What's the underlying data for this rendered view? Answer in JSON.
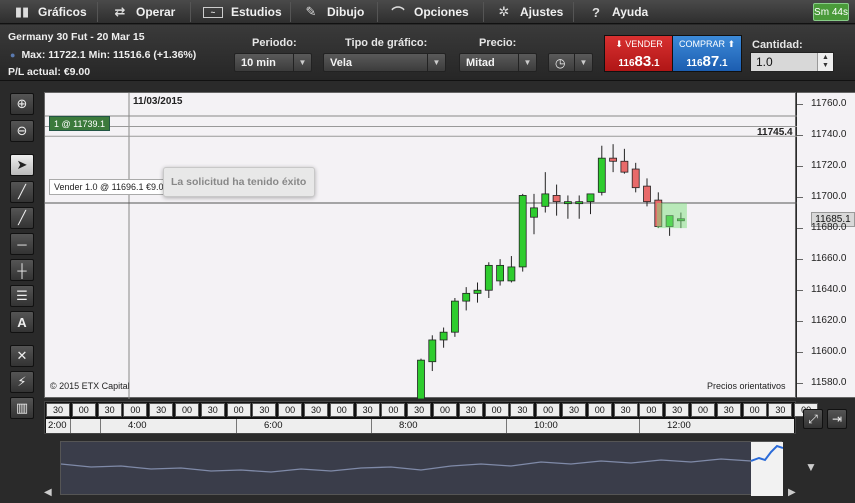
{
  "menu": {
    "graficos": "Gráficos",
    "operar": "Operar",
    "estudios": "Estudios",
    "dibujo": "Dibujo",
    "opciones": "Opciones",
    "ajustes": "Ajustes",
    "ayuda": "Ayuda",
    "timer": "Sm 44s"
  },
  "instrument": {
    "name": "Germany 30 Fut - 20 Mar 15",
    "range": "Max: 11722.1 Min: 11516.6 (+1.36%)",
    "pl": "P/L actual: €9.00"
  },
  "controls": {
    "period_label": "Periodo:",
    "period_value": "10 min",
    "charttype_label": "Tipo de gráfico:",
    "charttype_value": "Vela",
    "price_label": "Precio:",
    "price_value": "Mitad",
    "qty_label": "Cantidad:",
    "qty_value": "1.0"
  },
  "trade": {
    "sell_label": "VENDER",
    "sell_main": "116",
    "sell_big": "83",
    "sell_small": ".1",
    "buy_label": "COMPRAR",
    "buy_main": "116",
    "buy_big": "87",
    "buy_small": ".1"
  },
  "chart": {
    "date_label": "11/03/2015",
    "order_tag": "1 @ 11739.1",
    "position_tag": "Vender 1.0 @ 11696.1 €9.00",
    "toast": "La solicitud ha tenido éxito",
    "level_label": "11745.4",
    "last_price": "11685.1",
    "copyright": "© 2015 ETX Capital",
    "note": "Precios orientativos"
  },
  "chart_data": {
    "type": "candlestick",
    "ylim": [
      11570,
      11765
    ],
    "yticks": [
      11580.0,
      11600.0,
      11620.0,
      11640.0,
      11660.0,
      11680.0,
      11700.0,
      11720.0,
      11740.0,
      11760.0
    ],
    "tick_labels": [
      "11580.0",
      "11600.0",
      "11620.0",
      "11640.0",
      "11660.0",
      "11680.0",
      "11700.0",
      "11720.0",
      "11740.0",
      "11760.0"
    ],
    "horizontal_lines": [
      11745.4,
      11739.1,
      11696.1
    ],
    "candles": [
      {
        "o": 11570,
        "h": 11596,
        "l": 11560,
        "c": 11595,
        "up": true
      },
      {
        "o": 11594,
        "h": 11611,
        "l": 11588,
        "c": 11608,
        "up": true
      },
      {
        "o": 11608,
        "h": 11616,
        "l": 11603,
        "c": 11613,
        "up": true
      },
      {
        "o": 11613,
        "h": 11635,
        "l": 11610,
        "c": 11633,
        "up": true
      },
      {
        "o": 11633,
        "h": 11642,
        "l": 11627,
        "c": 11638,
        "up": true
      },
      {
        "o": 11638,
        "h": 11645,
        "l": 11632,
        "c": 11640,
        "up": true
      },
      {
        "o": 11640,
        "h": 11658,
        "l": 11635,
        "c": 11656,
        "up": true
      },
      {
        "o": 11646,
        "h": 11660,
        "l": 11643,
        "c": 11656,
        "up": true
      },
      {
        "o": 11646,
        "h": 11662,
        "l": 11645,
        "c": 11655,
        "up": true
      },
      {
        "o": 11655,
        "h": 11702,
        "l": 11652,
        "c": 11701,
        "up": true
      },
      {
        "o": 11687,
        "h": 11702,
        "l": 11676,
        "c": 11693,
        "up": true
      },
      {
        "o": 11694,
        "h": 11716,
        "l": 11690,
        "c": 11702,
        "up": true
      },
      {
        "o": 11701,
        "h": 11708,
        "l": 11688,
        "c": 11697,
        "up": false
      },
      {
        "o": 11697,
        "h": 11701,
        "l": 11686,
        "c": 11696,
        "up": true
      },
      {
        "o": 11697,
        "h": 11701,
        "l": 11686,
        "c": 11697,
        "up": true
      },
      {
        "o": 11697,
        "h": 11702,
        "l": 11689,
        "c": 11702,
        "up": true
      },
      {
        "o": 11703,
        "h": 11733,
        "l": 11701,
        "c": 11725,
        "up": true
      },
      {
        "o": 11725,
        "h": 11734,
        "l": 11716,
        "c": 11723,
        "up": false
      },
      {
        "o": 11723,
        "h": 11731,
        "l": 11715,
        "c": 11716,
        "up": false
      },
      {
        "o": 11718,
        "h": 11722,
        "l": 11703,
        "c": 11706,
        "up": false
      },
      {
        "o": 11707,
        "h": 11712,
        "l": 11694,
        "c": 11697,
        "up": false
      },
      {
        "o": 11698,
        "h": 11703,
        "l": 11680,
        "c": 11681,
        "up": false
      },
      {
        "o": 11681,
        "h": 11688,
        "l": 11675,
        "c": 11688,
        "up": true
      },
      {
        "o": 11685,
        "h": 11690,
        "l": 11680,
        "c": 11686,
        "up": true
      }
    ],
    "time_cells": [
      "30",
      "00",
      "30",
      "00",
      "30",
      "00",
      "30",
      "00",
      "30",
      "00",
      "30",
      "00",
      "30",
      "00",
      "30",
      "00",
      "30",
      "00",
      "30",
      "00",
      "30",
      "00",
      "30",
      "00",
      "30",
      "00",
      "30",
      "00",
      "30",
      "00"
    ],
    "hour_labels": [
      "2:00",
      "4:00",
      "6:00",
      "8:00",
      "10:00",
      "12:00"
    ]
  },
  "colors": {
    "up": "#2ecc2e",
    "down": "#e86a6a",
    "sell": "#c82020",
    "buy": "#2a70c8"
  }
}
